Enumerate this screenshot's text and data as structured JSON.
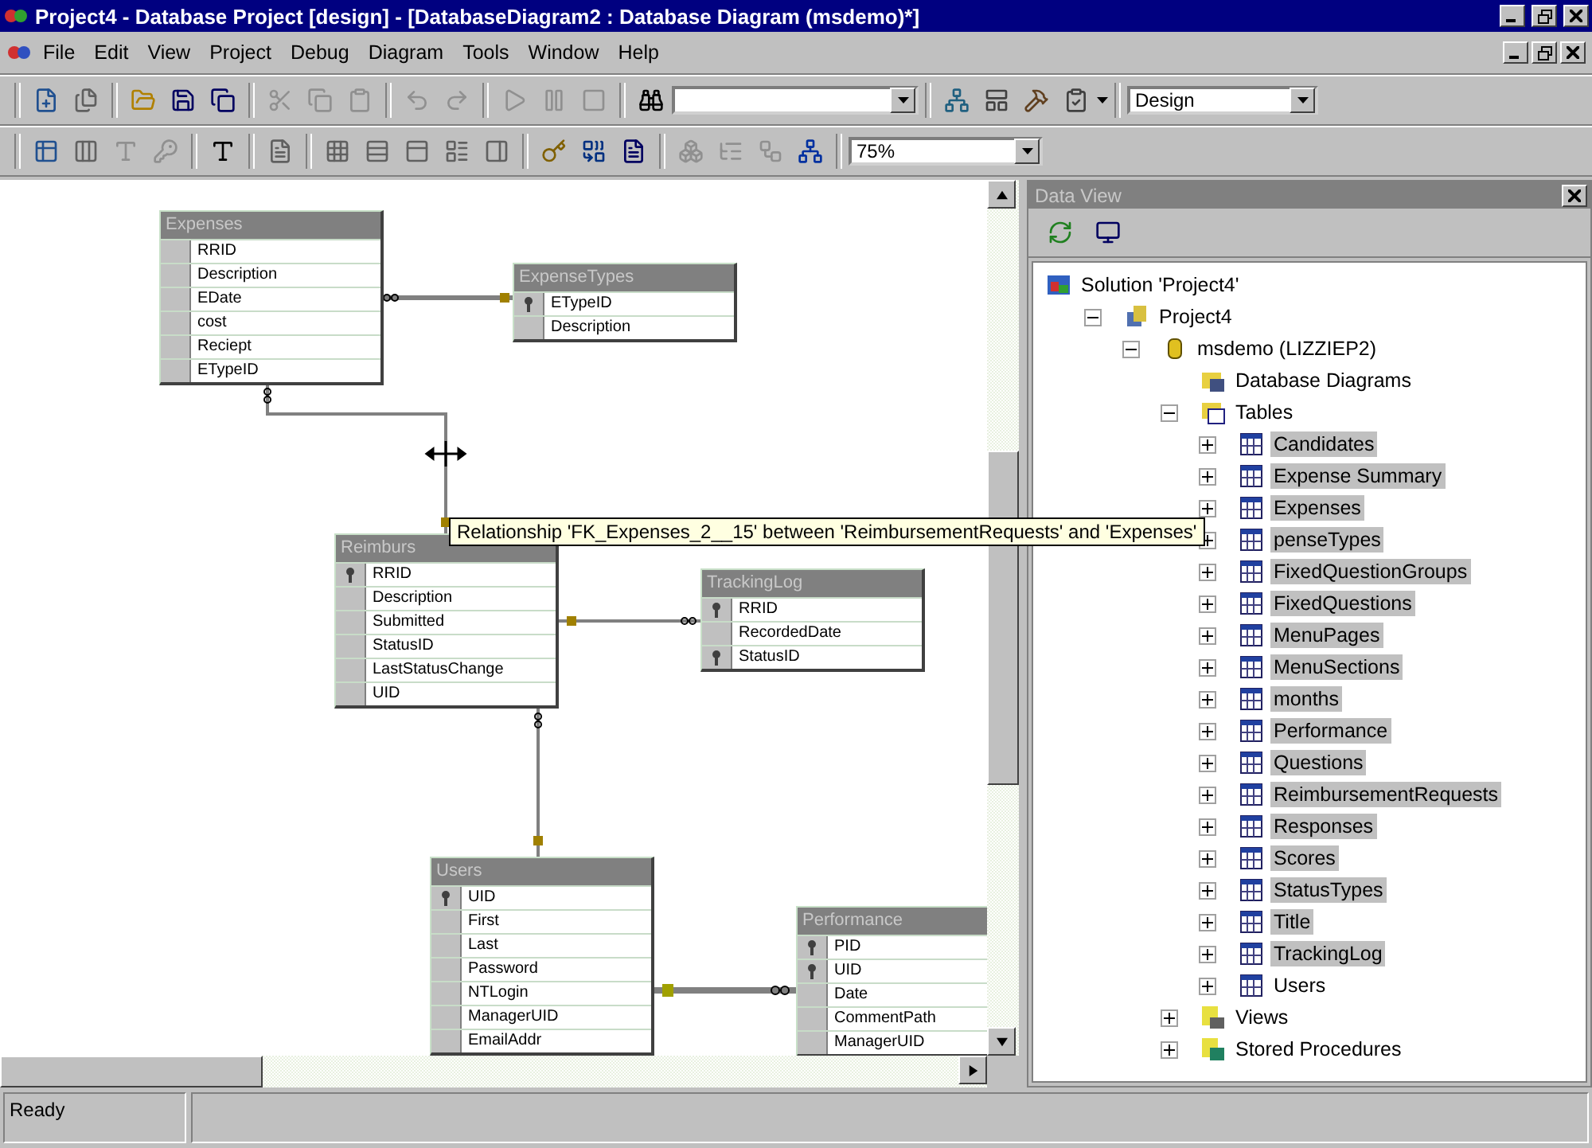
{
  "window": {
    "title": "Project4 - Database Project [design] - [DatabaseDiagram2 : Database Diagram (msdemo)*]"
  },
  "menu": [
    "File",
    "Edit",
    "View",
    "Project",
    "Debug",
    "Diagram",
    "Tools",
    "Window",
    "Help"
  ],
  "toolbar": {
    "configuration_combo": {
      "value": "Design"
    },
    "zoom_combo": {
      "value": "75%"
    }
  },
  "diagram": {
    "tables": [
      {
        "name": "Expenses",
        "columns": [
          {
            "name": "RRID",
            "primary_key": false
          },
          {
            "name": "Description",
            "primary_key": false
          },
          {
            "name": "EDate",
            "primary_key": false
          },
          {
            "name": "cost",
            "primary_key": false
          },
          {
            "name": "Reciept",
            "primary_key": false
          },
          {
            "name": "ETypeID",
            "primary_key": false
          }
        ]
      },
      {
        "name": "ExpenseTypes",
        "columns": [
          {
            "name": "ETypeID",
            "primary_key": true
          },
          {
            "name": "Description",
            "primary_key": false
          }
        ]
      },
      {
        "name": "Reimburs",
        "columns": [
          {
            "name": "RRID",
            "primary_key": true
          },
          {
            "name": "Description",
            "primary_key": false
          },
          {
            "name": "Submitted",
            "primary_key": false
          },
          {
            "name": "StatusID",
            "primary_key": false
          },
          {
            "name": "LastStatusChange",
            "primary_key": false
          },
          {
            "name": "UID",
            "primary_key": false
          }
        ]
      },
      {
        "name": "TrackingLog",
        "columns": [
          {
            "name": "RRID",
            "primary_key": true
          },
          {
            "name": "RecordedDate",
            "primary_key": false
          },
          {
            "name": "StatusID",
            "primary_key": true
          }
        ]
      },
      {
        "name": "Users",
        "columns": [
          {
            "name": "UID",
            "primary_key": true
          },
          {
            "name": "First",
            "primary_key": false
          },
          {
            "name": "Last",
            "primary_key": false
          },
          {
            "name": "Password",
            "primary_key": false
          },
          {
            "name": "NTLogin",
            "primary_key": false
          },
          {
            "name": "ManagerUID",
            "primary_key": false
          },
          {
            "name": "EmailAddr",
            "primary_key": false
          }
        ]
      },
      {
        "name": "Performance",
        "columns": [
          {
            "name": "PID",
            "primary_key": true
          },
          {
            "name": "UID",
            "primary_key": true
          },
          {
            "name": "Date",
            "primary_key": false
          },
          {
            "name": "CommentPath",
            "primary_key": false
          },
          {
            "name": "ManagerUID",
            "primary_key": false
          }
        ]
      }
    ],
    "tooltip": "Relationship 'FK_Expenses_2__15' between 'ReimbursementRequests' and 'Expenses'"
  },
  "data_view": {
    "title": "Data View",
    "tree": [
      {
        "label": "Solution 'Project4'",
        "kind": "solution",
        "selected": false,
        "children": [
          {
            "label": "Project4",
            "kind": "project",
            "expanded": true,
            "selected": false,
            "children": [
              {
                "label": "msdemo (LIZZIEP2)",
                "kind": "database",
                "expanded": true,
                "selected": false,
                "children": [
                  {
                    "label": "Database Diagrams",
                    "kind": "diagrams",
                    "selected": false
                  },
                  {
                    "label": "Tables",
                    "kind": "tables",
                    "expanded": true,
                    "selected": false,
                    "children": [
                      {
                        "label": "Candidates",
                        "kind": "table",
                        "expanded": false,
                        "selected": true
                      },
                      {
                        "label": "Expense Summary",
                        "kind": "table",
                        "expanded": false,
                        "selected": true
                      },
                      {
                        "label": "Expenses",
                        "kind": "table",
                        "expanded": false,
                        "selected": true
                      },
                      {
                        "label": "penseTypes",
                        "kind": "table",
                        "expanded": false,
                        "selected": true
                      },
                      {
                        "label": "FixedQuestionGroups",
                        "kind": "table",
                        "expanded": false,
                        "selected": true
                      },
                      {
                        "label": "FixedQuestions",
                        "kind": "table",
                        "expanded": false,
                        "selected": true
                      },
                      {
                        "label": "MenuPages",
                        "kind": "table",
                        "expanded": false,
                        "selected": true
                      },
                      {
                        "label": "MenuSections",
                        "kind": "table",
                        "expanded": false,
                        "selected": true
                      },
                      {
                        "label": "months",
                        "kind": "table",
                        "expanded": false,
                        "selected": true
                      },
                      {
                        "label": "Performance",
                        "kind": "table",
                        "expanded": false,
                        "selected": true
                      },
                      {
                        "label": "Questions",
                        "kind": "table",
                        "expanded": false,
                        "selected": true
                      },
                      {
                        "label": "ReimbursementRequests",
                        "kind": "table",
                        "expanded": false,
                        "selected": true
                      },
                      {
                        "label": "Responses",
                        "kind": "table",
                        "expanded": false,
                        "selected": true
                      },
                      {
                        "label": "Scores",
                        "kind": "table",
                        "expanded": false,
                        "selected": true
                      },
                      {
                        "label": "StatusTypes",
                        "kind": "table",
                        "expanded": false,
                        "selected": true
                      },
                      {
                        "label": "Title",
                        "kind": "table",
                        "expanded": false,
                        "selected": true
                      },
                      {
                        "label": "TrackingLog",
                        "kind": "table",
                        "expanded": false,
                        "selected": true
                      },
                      {
                        "label": "Users",
                        "kind": "table",
                        "expanded": false,
                        "selected": false
                      }
                    ]
                  },
                  {
                    "label": "Views",
                    "kind": "views",
                    "expanded": false,
                    "selected": false
                  },
                  {
                    "label": "Stored Procedures",
                    "kind": "procedures",
                    "expanded": false,
                    "selected": false
                  }
                ]
              }
            ]
          }
        ]
      }
    ]
  },
  "status_bar": {
    "text": "Ready"
  }
}
